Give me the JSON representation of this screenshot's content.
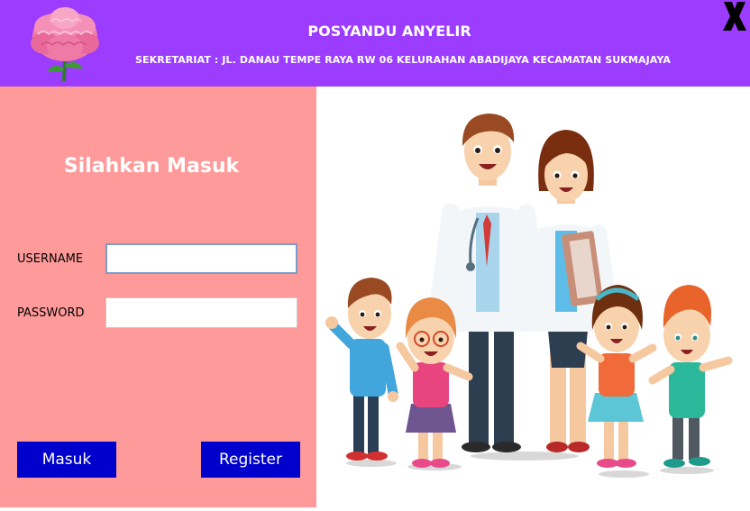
{
  "header": {
    "title": "POSYANDU ANYELIR",
    "subtitle": "SEKRETARIAT : JL. DANAU TEMPE RAYA RW 06 KELURAHAN ABADIJAYA KECAMATAN SUKMAJAYA",
    "logo_icon": "carnation-flower-icon",
    "close_icon": "close-x-icon",
    "background_color": "#9b3cff"
  },
  "login": {
    "heading": "Silahkan Masuk",
    "username_label": "USERNAME",
    "username_value": "",
    "password_label": "PASSWORD",
    "password_value": "",
    "masuk_label": "Masuk",
    "register_label": "Register",
    "panel_color": "#ff9a9a",
    "button_color": "#0000cc"
  },
  "illustration": {
    "icon": "doctors-and-children-illustration"
  }
}
